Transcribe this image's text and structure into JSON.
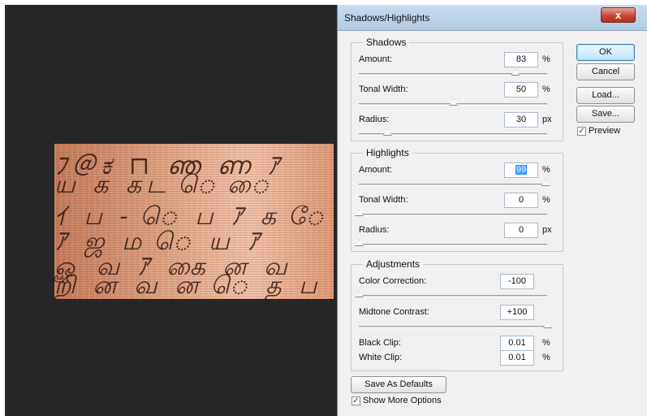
{
  "canvas": {
    "background": "#262626",
    "script_lines": [
      "ﾌ＠ಕ ⊓ ഞ ണ ｱ",
      "ய க கட ெ ை",
      "ｲ ப - ெ ப ｱ க ே",
      "ｱ ஜ ம ெ ய ｱ ",
      "ௐ வ ｱ கை ன வ",
      "றி ன வ ன ெ த ப"
    ]
  },
  "dialog": {
    "title": "Shadows/Highlights",
    "close_glyph": "x",
    "shadows": {
      "legend": "Shadows",
      "amount": {
        "label": "Amount:",
        "value": "83",
        "unit": "%",
        "pos": 83
      },
      "tonal_width": {
        "label": "Tonal Width:",
        "value": "50",
        "unit": "%",
        "pos": 50
      },
      "radius": {
        "label": "Radius:",
        "value": "30",
        "unit": "px",
        "pos": 15
      }
    },
    "highlights": {
      "legend": "Highlights",
      "amount": {
        "label": "Amount:",
        "value": "99",
        "unit": "%",
        "pos": 99
      },
      "tonal_width": {
        "label": "Tonal Width:",
        "value": "0",
        "unit": "%",
        "pos": 0
      },
      "radius": {
        "label": "Radius:",
        "value": "0",
        "unit": "px",
        "pos": 0
      }
    },
    "adjustments": {
      "legend": "Adjustments",
      "color_correction": {
        "label": "Color Correction:",
        "value": "-100",
        "pos": 0
      },
      "midtone_contrast": {
        "label": "Midtone Contrast:",
        "value": "+100",
        "pos": 100
      },
      "black_clip": {
        "label": "Black Clip:",
        "value": "0.01",
        "unit": "%"
      },
      "white_clip": {
        "label": "White Clip:",
        "value": "0.01",
        "unit": "%"
      }
    },
    "buttons": {
      "ok": "OK",
      "cancel": "Cancel",
      "load": "Load...",
      "save": "Save...",
      "save_defaults": "Save As Defaults"
    },
    "checkboxes": {
      "preview": {
        "label": "Preview",
        "checked": true
      },
      "show_more": {
        "label": "Show More Options",
        "checked": true
      }
    }
  }
}
